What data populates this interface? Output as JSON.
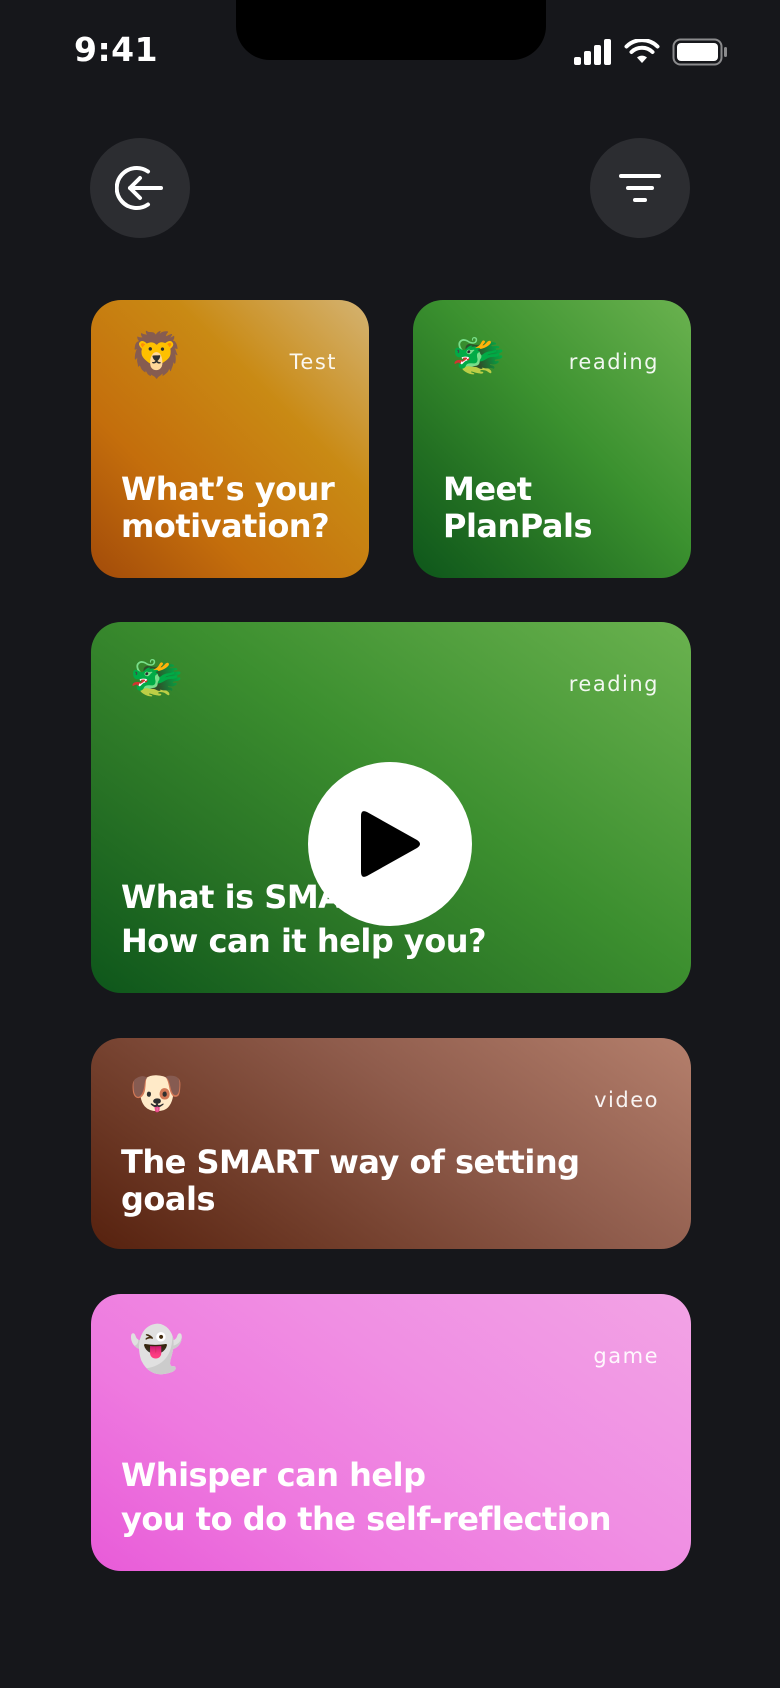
{
  "status": {
    "time": "9:41"
  },
  "header": {
    "back_icon": "back-arrow-circle-icon",
    "filter_icon": "filter-icon"
  },
  "cards": [
    {
      "tag": "Test",
      "title": "What’s your motivation?",
      "emoji": "🦁",
      "icon": "lion-emoji"
    },
    {
      "tag": "reading",
      "title": "Meet PlanPals",
      "emoji": "🐲",
      "icon": "dragon-emoji"
    },
    {
      "tag": "reading",
      "title_line1": "What is SMART?",
      "title_line2": "How can it help you?",
      "emoji": "🐲",
      "icon": "dragon-emoji"
    },
    {
      "tag": "video",
      "title": "The SMART way of setting goals",
      "emoji": "🐶",
      "icon": "dog-emoji"
    },
    {
      "tag": "game",
      "title_line1": "Whisper can help",
      "title_line2": "you to do the self-reflection",
      "emoji": "👻",
      "icon": "ghost-emoji"
    }
  ],
  "colors": {
    "background": "#16171b",
    "button_bg": "#2c2d31",
    "orange": "#c98a14",
    "green": "#3b912f",
    "brown": "#8f5c4c",
    "pink": "#f08ee3"
  }
}
